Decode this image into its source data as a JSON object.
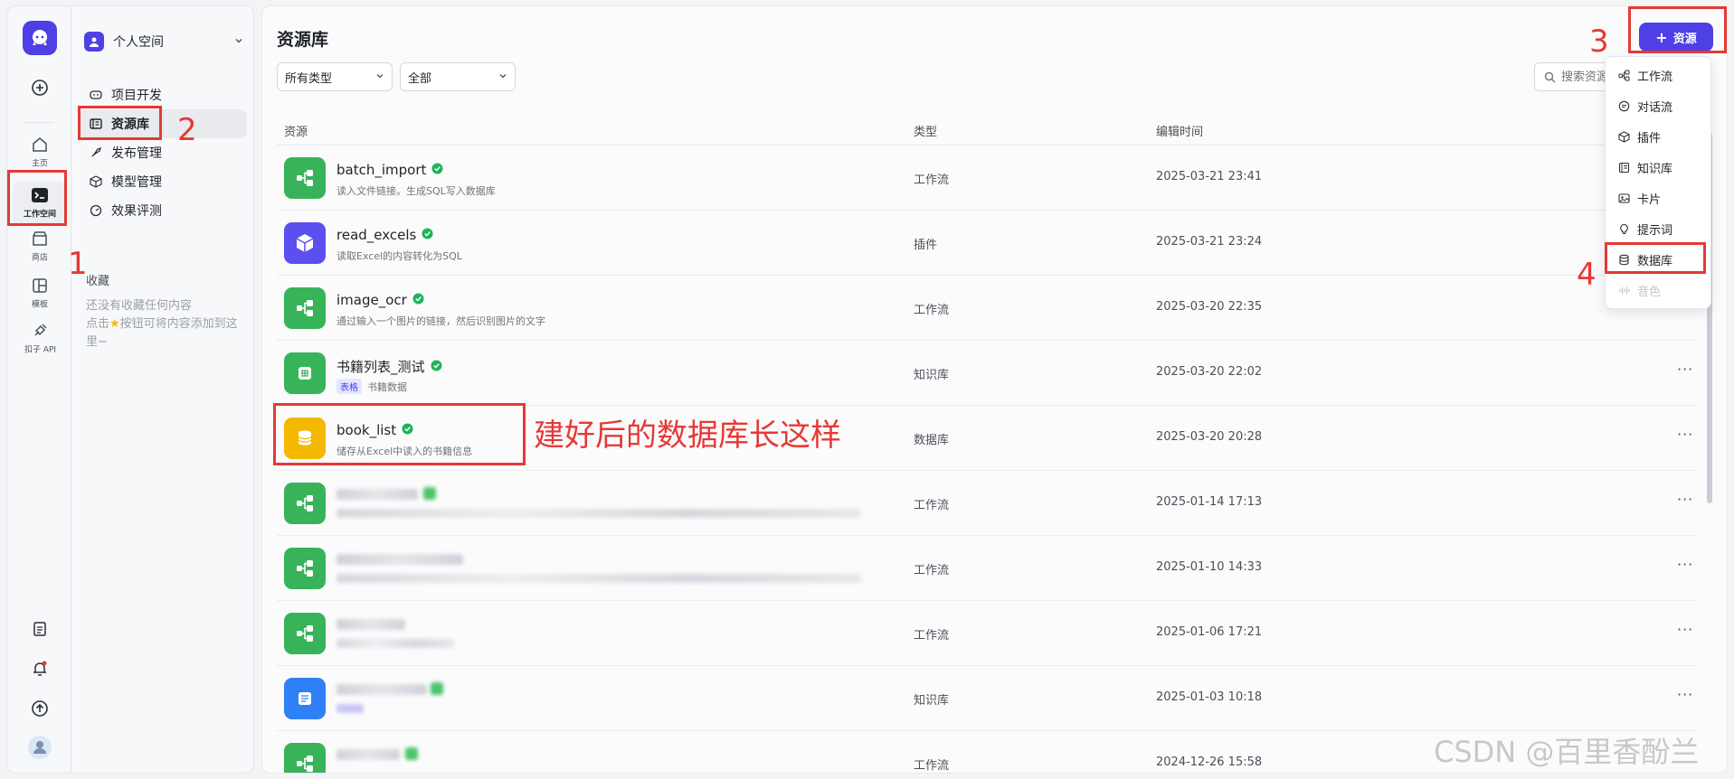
{
  "rail": {
    "items": [
      {
        "label": "主页"
      },
      {
        "label": "工作空间"
      },
      {
        "label": "商店"
      },
      {
        "label": "模板"
      },
      {
        "label": "扣子 API"
      }
    ]
  },
  "sidebar": {
    "space_name": "个人空间",
    "items": [
      {
        "label": "项目开发"
      },
      {
        "label": "资源库"
      },
      {
        "label": "发布管理"
      },
      {
        "label": "模型管理"
      },
      {
        "label": "效果评测"
      }
    ],
    "favorites_title": "收藏",
    "favorites_empty_1": "还没有收藏任何内容",
    "favorites_empty_2": "点击",
    "favorites_empty_3": "按钮可将内容添加到这里~"
  },
  "main": {
    "title": "资源库",
    "filter_type": "所有类型",
    "filter_scope": "全部",
    "search_placeholder": "搜索资源",
    "add_button": "资源",
    "columns": {
      "resource": "资源",
      "type": "类型",
      "edited": "编辑时间"
    },
    "rows": [
      {
        "name": "batch_import",
        "desc": "读入文件链接。生成SQL写入数据库",
        "type": "工作流",
        "time": "2025-03-21 23:41"
      },
      {
        "name": "read_excels",
        "desc": "读取Excel的内容转化为SQL",
        "type": "插件",
        "time": "2025-03-21 23:24"
      },
      {
        "name": "image_ocr",
        "desc": "通过输入一个图片的链接，然后识别图片的文字",
        "type": "工作流",
        "time": "2025-03-20 22:35"
      },
      {
        "name": "书籍列表_测试",
        "tag": "表格",
        "desc": "书籍数据",
        "type": "知识库",
        "time": "2025-03-20 22:02"
      },
      {
        "name": "book_list",
        "desc": "储存从Excel中读入的书籍信息",
        "type": "数据库",
        "time": "2025-03-20 20:28"
      },
      {
        "name": "",
        "desc": "",
        "type": "工作流",
        "time": "2025-01-14 17:13"
      },
      {
        "name": "",
        "desc": "",
        "type": "工作流",
        "time": "2025-01-10 14:33"
      },
      {
        "name": "",
        "desc": "",
        "type": "工作流",
        "time": "2025-01-06 17:21"
      },
      {
        "name": "",
        "desc": "",
        "type": "知识库",
        "time": "2025-01-03 10:18"
      },
      {
        "name": "",
        "desc": "",
        "type": "工作流",
        "time": "2024-12-26 15:58"
      }
    ],
    "more": "···"
  },
  "menu": {
    "items": [
      {
        "label": "工作流"
      },
      {
        "label": "对话流"
      },
      {
        "label": "插件"
      },
      {
        "label": "知识库"
      },
      {
        "label": "卡片"
      },
      {
        "label": "提示词"
      },
      {
        "label": "数据库"
      },
      {
        "label": "音色"
      }
    ]
  },
  "annotations": {
    "n1": "1",
    "n2": "2",
    "n3": "3",
    "n4": "4",
    "note": "建好后的数据库长这样"
  },
  "watermark": "CSDN @百里香酚兰",
  "colors": {
    "accent": "#4e40e5",
    "annotation": "#e53935",
    "workflow": "#38b35a",
    "plugin": "#5b4ff0",
    "knowledge": "#2f7ff5",
    "database": "#f5b800"
  }
}
